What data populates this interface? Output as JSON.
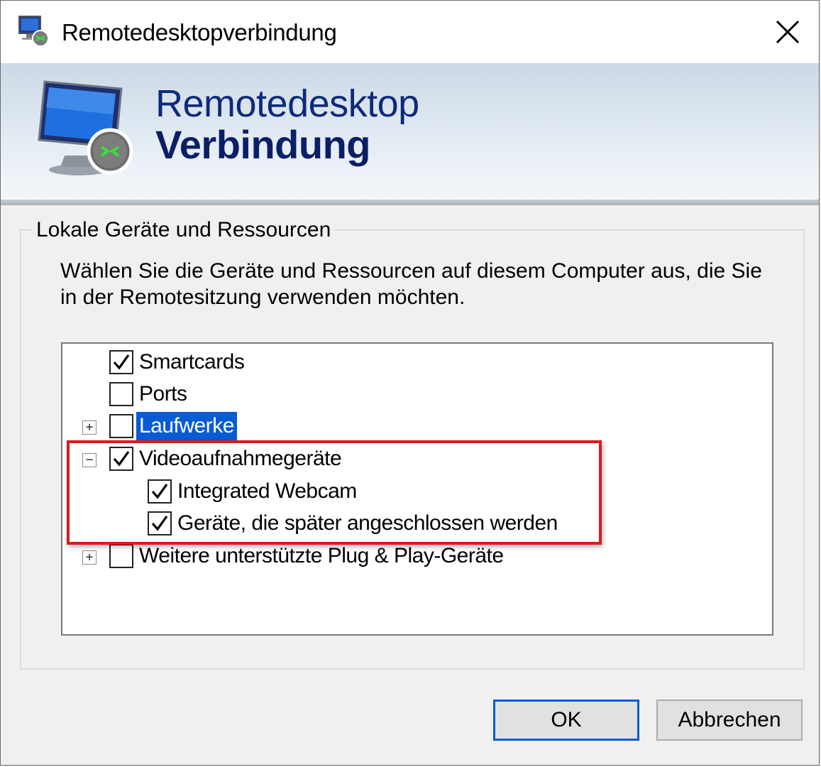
{
  "window": {
    "title": "Remotedesktopverbindung"
  },
  "banner": {
    "line1": "Remotedesktop",
    "line2": "Verbindung"
  },
  "group": {
    "legend": "Lokale Geräte und Ressourcen",
    "description": "Wählen Sie die Geräte und Ressourcen auf diesem Computer aus, die Sie in der Remotesitzung verwenden möchten."
  },
  "tree": {
    "items": [
      {
        "label": "Smartcards",
        "checked": true
      },
      {
        "label": "Ports",
        "checked": false
      },
      {
        "label": "Laufwerke",
        "checked": false,
        "expander": "+",
        "selected": true
      },
      {
        "label": "Videoaufnahmegeräte",
        "checked": true,
        "expander": "−"
      },
      {
        "label": "Integrated Webcam",
        "checked": true
      },
      {
        "label": "Geräte, die später angeschlossen werden",
        "checked": true
      },
      {
        "label": "Weitere unterstützte Plug & Play-Geräte",
        "checked": false,
        "expander": "+"
      }
    ]
  },
  "buttons": {
    "ok": "OK",
    "cancel": "Abbrechen"
  },
  "colors": {
    "selection": "#0a5bd3",
    "highlight_border": "#e0181e",
    "banner_title": "#0e2a7a"
  }
}
